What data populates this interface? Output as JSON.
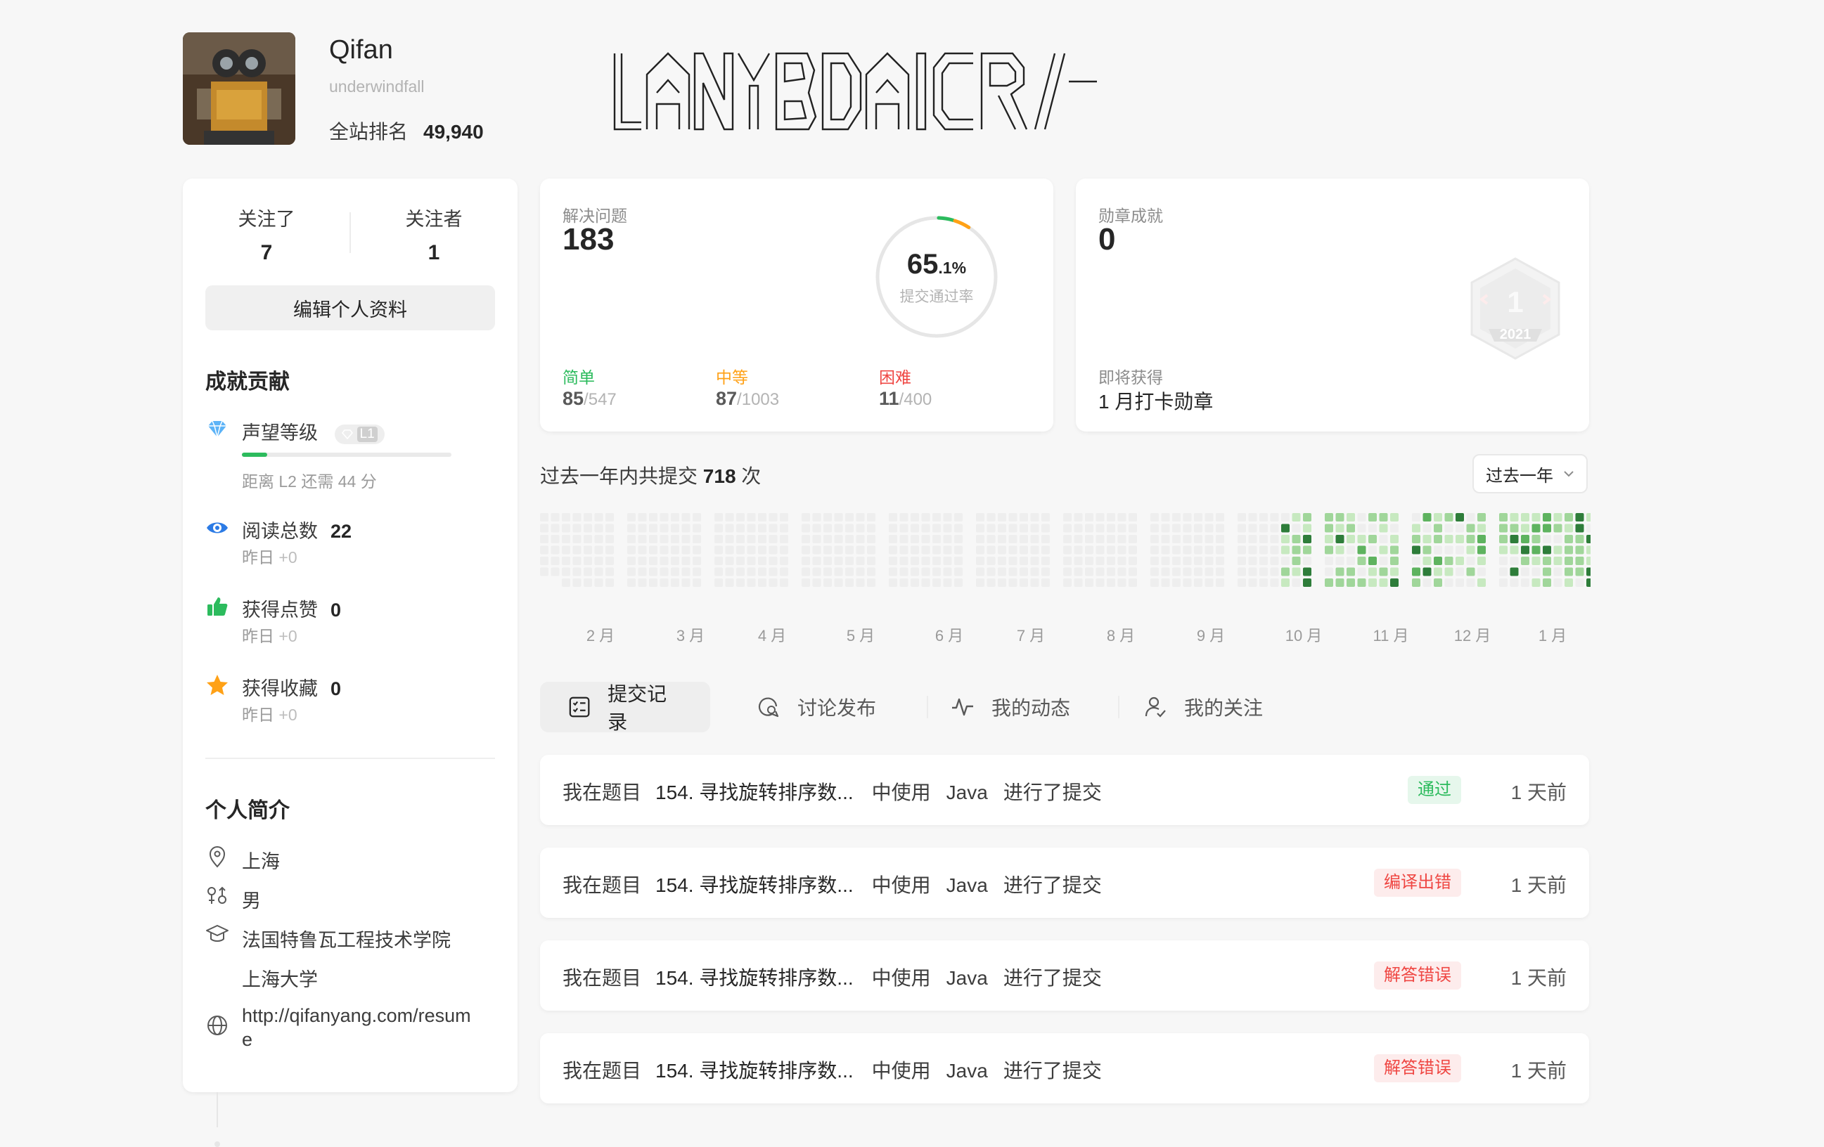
{
  "profile": {
    "name": "Qifan",
    "handle": "underwindfall",
    "rank_label": "全站排名",
    "rank_value": "49,940",
    "ascii_art_text": "LANYBDAICR"
  },
  "follow": {
    "following_label": "关注了",
    "following_count": "7",
    "followers_label": "关注者",
    "followers_count": "1"
  },
  "edit_profile_label": "编辑个人资料",
  "contrib": {
    "title": "成就贡献",
    "reputation": {
      "label": "声望等级",
      "badge": "L1",
      "hint": "距离 L2 还需 44 分",
      "progress": 0.12
    },
    "reads": {
      "label": "阅读总数",
      "value": "22",
      "sub_prefix": "昨日",
      "sub_value": "+0"
    },
    "likes": {
      "label": "获得点赞",
      "value": "0",
      "sub_prefix": "昨日",
      "sub_value": "+0"
    },
    "favorites": {
      "label": "获得收藏",
      "value": "0",
      "sub_prefix": "昨日",
      "sub_value": "+0"
    }
  },
  "bio": {
    "title": "个人简介",
    "location": "上海",
    "gender": "男",
    "school_1": "法国特鲁瓦工程技术学院",
    "school_2": "上海大学",
    "website_line1": "http://qifanyang.com/resum",
    "website_line2": "e"
  },
  "solved": {
    "label": "解决问题",
    "value": "183",
    "acceptance_int": "65",
    "acceptance_dec": ".1%",
    "acceptance_label": "提交通过率",
    "acceptance_fraction": 0.651,
    "easy": {
      "label": "简单",
      "solved": "85",
      "total": "/547",
      "color": "#2cbb5d"
    },
    "medium": {
      "label": "中等",
      "solved": "87",
      "total": "/1003",
      "color": "#ffa116"
    },
    "hard": {
      "label": "困难",
      "solved": "11",
      "total": "/400",
      "color": "#ef4743"
    }
  },
  "badges": {
    "label": "勋章成就",
    "value": "0",
    "upcoming_label": "即将获得",
    "upcoming_name": "1 月打卡勋章",
    "badge_number": "1",
    "badge_year": "2021"
  },
  "submissions": {
    "prefix": "过去一年内共提交",
    "count": "718",
    "suffix": "次",
    "range_select": "过去一年",
    "months": [
      "2 月",
      "3 月",
      "4 月",
      "5 月",
      "6 月",
      "7 月",
      "8 月",
      "9 月",
      "10 月",
      "11 月",
      "12 月",
      "1 月"
    ]
  },
  "tabs": [
    {
      "label": "提交记录",
      "icon": "checklist-icon"
    },
    {
      "label": "讨论发布",
      "icon": "discussion-icon"
    },
    {
      "label": "我的动态",
      "icon": "activity-icon"
    },
    {
      "label": "我的关注",
      "icon": "user-follow-icon"
    }
  ],
  "records": [
    {
      "prefix": "我在题目",
      "problem": "154. 寻找旋转排序数...",
      "mid": "中使用",
      "lang": "Java",
      "suffix": "进行了提交",
      "status": "通过",
      "status_color": "#2cbb5d",
      "status_bg": "#e6f7ec",
      "time": "1 天前"
    },
    {
      "prefix": "我在题目",
      "problem": "154. 寻找旋转排序数...",
      "mid": "中使用",
      "lang": "Java",
      "suffix": "进行了提交",
      "status": "编译出错",
      "status_color": "#ef4743",
      "status_bg": "#fdecec",
      "time": "1 天前"
    },
    {
      "prefix": "我在题目",
      "problem": "154. 寻找旋转排序数...",
      "mid": "中使用",
      "lang": "Java",
      "suffix": "进行了提交",
      "status": "解答错误",
      "status_color": "#ef4743",
      "status_bg": "#fdecec",
      "time": "1 天前"
    },
    {
      "prefix": "我在题目",
      "problem": "154. 寻找旋转排序数...",
      "mid": "中使用",
      "lang": "Java",
      "suffix": "进行了提交",
      "status": "解答错误",
      "status_color": "#ef4743",
      "status_bg": "#fdecec",
      "time": "1 天前"
    }
  ]
}
